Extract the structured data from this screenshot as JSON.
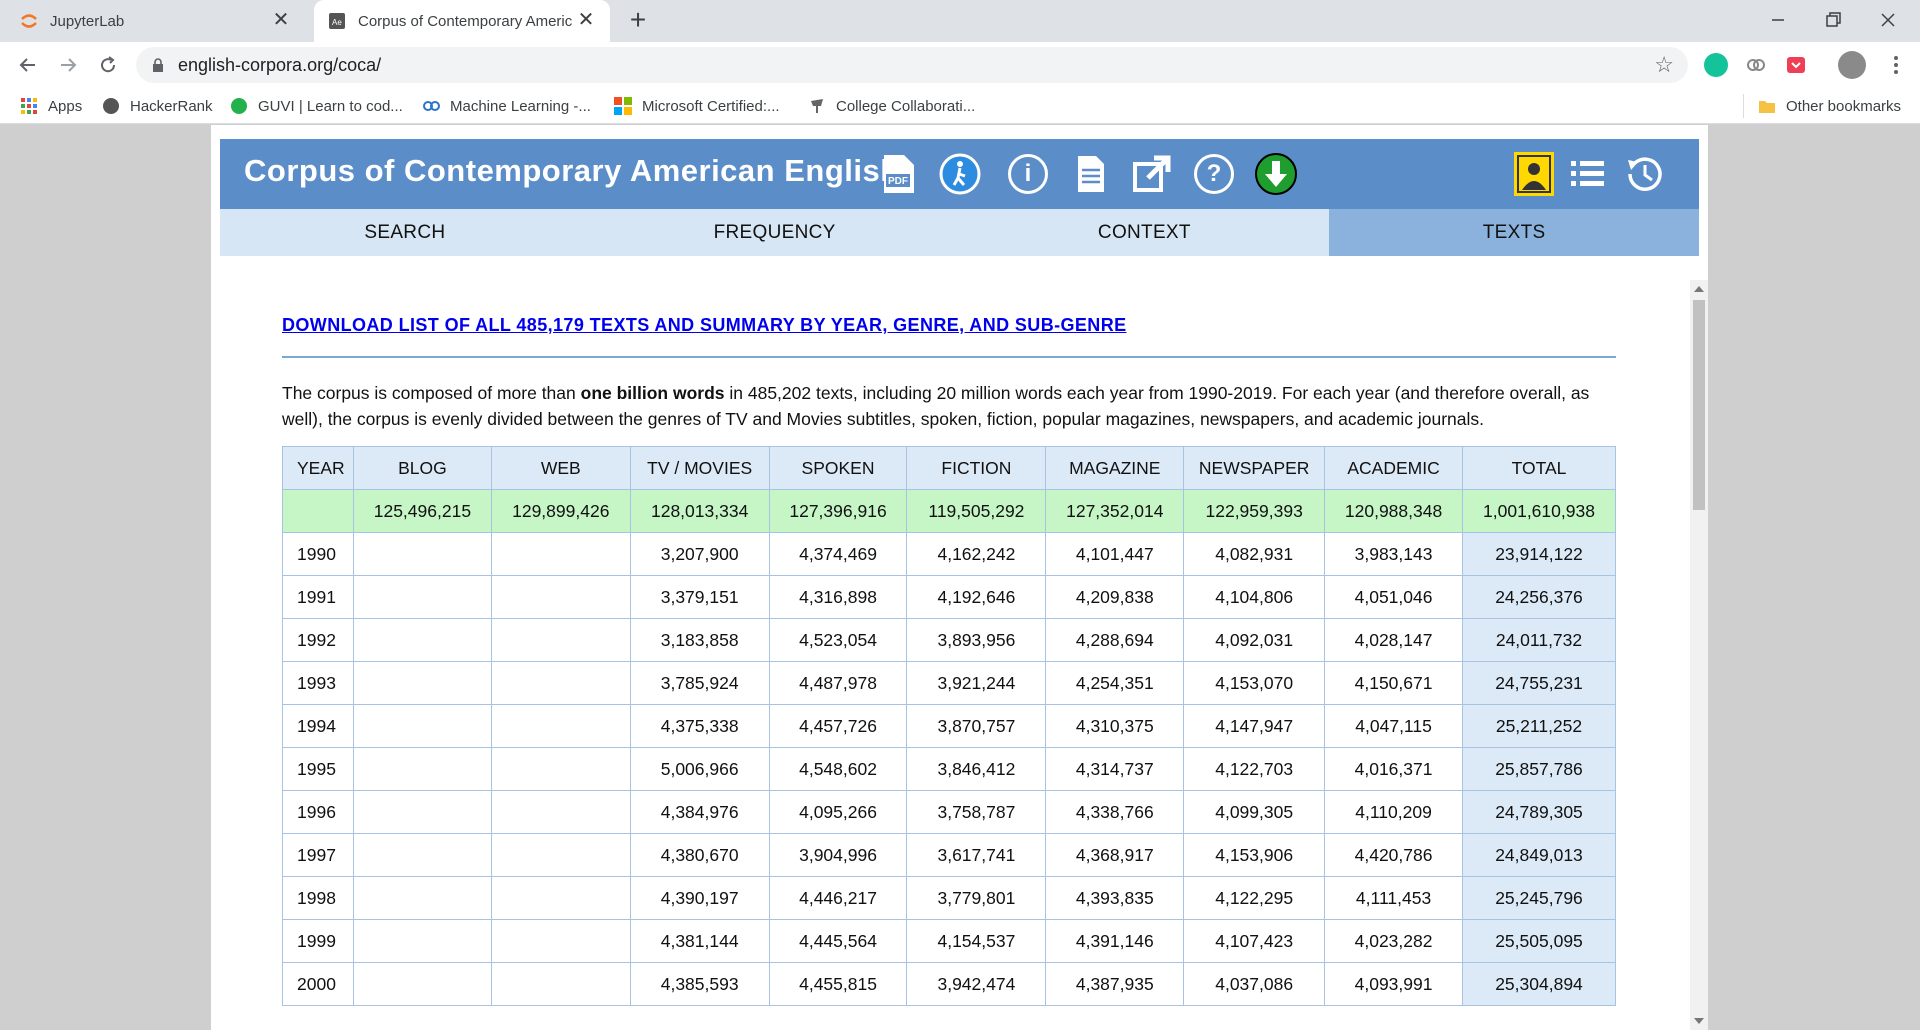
{
  "browser": {
    "tabs": [
      {
        "title": "JupyterLab",
        "close": "✕"
      },
      {
        "title": "Corpus of Contemporary Americ",
        "close": "✕"
      }
    ],
    "new_tab": "+",
    "url": "english-corpora.org/coca/",
    "bookmarks": [
      {
        "label": "Apps"
      },
      {
        "label": "HackerRank"
      },
      {
        "label": "GUVI | Learn to cod..."
      },
      {
        "label": "Machine Learning -..."
      },
      {
        "label": "Microsoft Certified:..."
      },
      {
        "label": "College Collaborati..."
      },
      {
        "label": "Other bookmarks"
      }
    ]
  },
  "site": {
    "title": "Corpus of Contemporary American English",
    "icons": [
      "pdf-icon",
      "tour-icon",
      "info-icon",
      "document-icon",
      "share-icon",
      "help-icon",
      "download-icon",
      "user-icon",
      "list-icon",
      "history-icon"
    ],
    "nav": [
      "SEARCH",
      "FREQUENCY",
      "CONTEXT",
      "TEXTS"
    ],
    "active_nav": "TEXTS"
  },
  "content": {
    "download_link": "DOWNLOAD LIST OF ALL 485,179 TEXTS AND SUMMARY BY YEAR, GENRE, AND SUB-GENRE",
    "intro_pre": "The corpus is composed of more than ",
    "intro_bold": "one billion words",
    "intro_post": " in 485,202 texts, including 20 million words each year from 1990-2019. For each year (and therefore overall, as well), the corpus is evenly divided between the genres of TV and Movies subtitles, spoken, fiction, popular magazines, newspapers, and academic journals."
  },
  "table": {
    "headers": [
      "YEAR",
      "BLOG",
      "WEB",
      "TV / MOVIES",
      "SPOKEN",
      "FICTION",
      "MAGAZINE",
      "NEWSPAPER",
      "ACADEMIC",
      "TOTAL"
    ],
    "totals": [
      "",
      "125,496,215",
      "129,899,426",
      "128,013,334",
      "127,396,916",
      "119,505,292",
      "127,352,014",
      "122,959,393",
      "120,988,348",
      "1,001,610,938"
    ],
    "rows": [
      [
        "1990",
        "",
        "",
        "3,207,900",
        "4,374,469",
        "4,162,242",
        "4,101,447",
        "4,082,931",
        "3,983,143",
        "23,914,122"
      ],
      [
        "1991",
        "",
        "",
        "3,379,151",
        "4,316,898",
        "4,192,646",
        "4,209,838",
        "4,104,806",
        "4,051,046",
        "24,256,376"
      ],
      [
        "1992",
        "",
        "",
        "3,183,858",
        "4,523,054",
        "3,893,956",
        "4,288,694",
        "4,092,031",
        "4,028,147",
        "24,011,732"
      ],
      [
        "1993",
        "",
        "",
        "3,785,924",
        "4,487,978",
        "3,921,244",
        "4,254,351",
        "4,153,070",
        "4,150,671",
        "24,755,231"
      ],
      [
        "1994",
        "",
        "",
        "4,375,338",
        "4,457,726",
        "3,870,757",
        "4,310,375",
        "4,147,947",
        "4,047,115",
        "25,211,252"
      ],
      [
        "1995",
        "",
        "",
        "5,006,966",
        "4,548,602",
        "3,846,412",
        "4,314,737",
        "4,122,703",
        "4,016,371",
        "25,857,786"
      ],
      [
        "1996",
        "",
        "",
        "4,384,976",
        "4,095,266",
        "3,758,787",
        "4,338,766",
        "4,099,305",
        "4,110,209",
        "24,789,305"
      ],
      [
        "1997",
        "",
        "",
        "4,380,670",
        "3,904,996",
        "3,617,741",
        "4,368,917",
        "4,153,906",
        "4,420,786",
        "24,849,013"
      ],
      [
        "1998",
        "",
        "",
        "4,390,197",
        "4,446,217",
        "3,779,801",
        "4,393,835",
        "4,122,295",
        "4,111,453",
        "25,245,796"
      ],
      [
        "1999",
        "",
        "",
        "4,381,144",
        "4,445,564",
        "4,154,537",
        "4,391,146",
        "4,107,423",
        "4,023,282",
        "25,505,095"
      ],
      [
        "2000",
        "",
        "",
        "4,385,593",
        "4,455,815",
        "3,942,474",
        "4,387,935",
        "4,037,086",
        "4,093,991",
        "25,304,894"
      ]
    ]
  }
}
